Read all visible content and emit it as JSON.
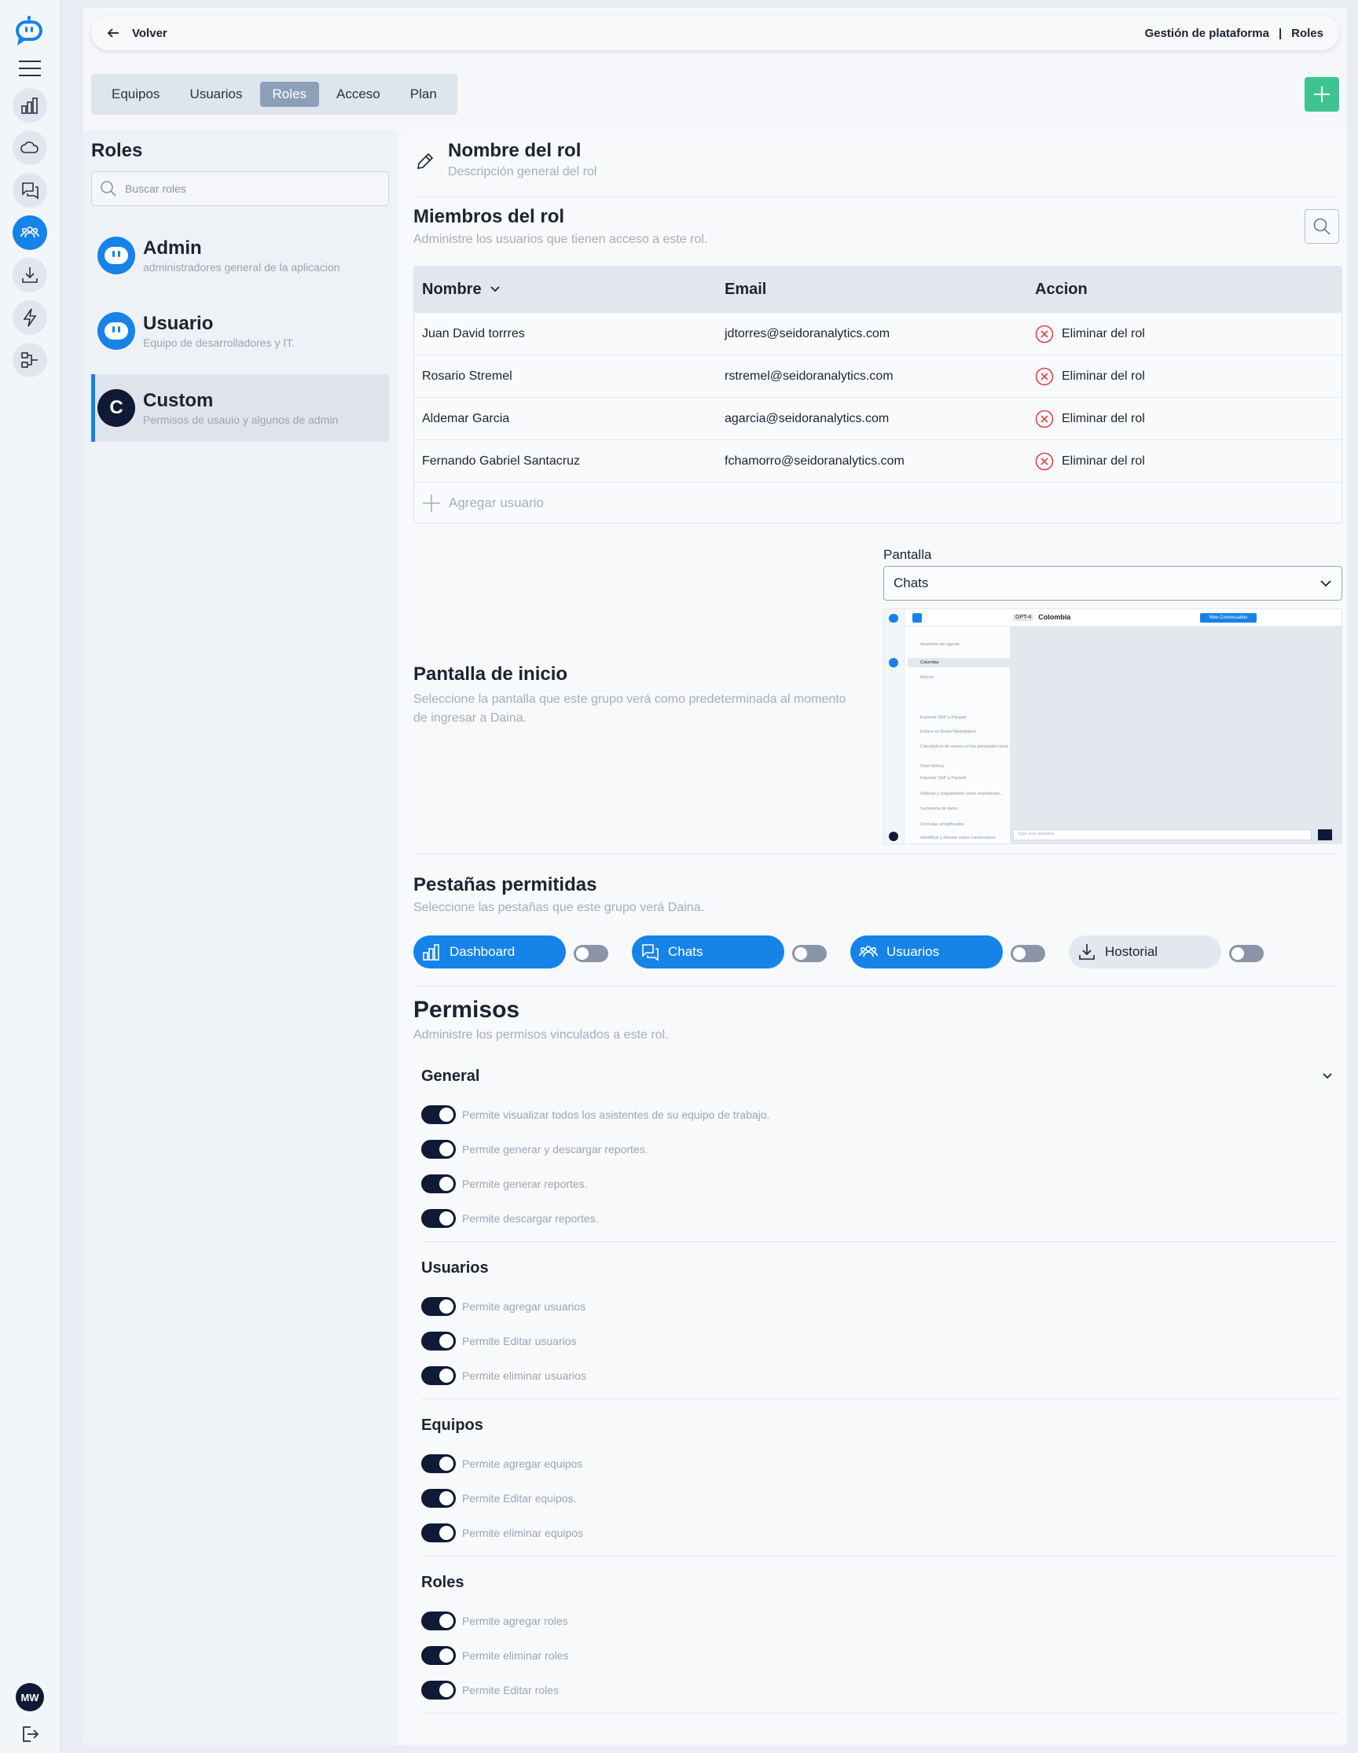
{
  "sidebar": {
    "avatar_initials": "MW",
    "items": [
      {
        "icon": "chart-icon"
      },
      {
        "icon": "cloud-icon"
      },
      {
        "icon": "chats-icon"
      },
      {
        "icon": "users-icon",
        "active": true
      },
      {
        "icon": "download-icon"
      },
      {
        "icon": "bolt-icon"
      },
      {
        "icon": "flow-icon"
      }
    ]
  },
  "topbar": {
    "back_label": "Volver",
    "crumb_1": "Gestión de plataforma",
    "crumb_sep": "|",
    "crumb_2": "Roles"
  },
  "tabs": [
    "Equipos",
    "Usuarios",
    "Roles",
    "Acceso",
    "Plan"
  ],
  "active_tab": "Roles",
  "roles": {
    "title": "Roles",
    "search_placeholder": "Buscar roles",
    "items": [
      {
        "name": "Admin",
        "desc": "administradores general de la aplicacion"
      },
      {
        "name": "Usuario",
        "desc": "Equipo de desarrolladores y IT."
      },
      {
        "name": "Custom",
        "desc": "Permisos de usauio y algunos de admin",
        "initial": "C"
      }
    ]
  },
  "role_header": {
    "title": "Nombre del rol",
    "subtitle": "Descripción general del rol"
  },
  "members": {
    "title": "Miembros del rol",
    "subtitle": "Administre los usuarios que tienen acceso a este rol.",
    "columns": [
      "Nombre",
      "Email",
      "Accion"
    ],
    "rows": [
      {
        "name": "Juan David torrres",
        "email": "jdtorres@seidoranalytics.com",
        "action": "Eliminar del rol"
      },
      {
        "name": "Rosario Stremel",
        "email": "rstremel@seidoranalytics.com",
        "action": "Eliminar del rol"
      },
      {
        "name": "Aldemar Garcia",
        "email": "agarcia@seidoranalytics.com",
        "action": "Eliminar del rol"
      },
      {
        "name": "Fernando Gabriel Santacruz",
        "email": "fchamorro@seidoranalytics.com",
        "action": "Eliminar del rol"
      }
    ],
    "add_label": "Agregar usuario"
  },
  "home_screen": {
    "title": "Pantalla de inicio",
    "subtitle": "Seleccione la pantalla que este grupo verá como predeterminada al momento de ingresar a Daina.",
    "select_label": "Pantalla",
    "select_value": "Chats",
    "preview_country": "Colombia",
    "preview_model": "GPT-4",
    "preview_button": "New Conversation",
    "preview_placeholder": "Type your question",
    "preview_items": [
      "Asistente del agente",
      "Colombia",
      "México"
    ],
    "preview_list": [
      "Exportar SAP a Parquet",
      "Enlace en Bolsa Marketplace",
      "Calculadora de ventas en los principales prod..."
    ],
    "preview_list2_title": "Chat History",
    "preview_list2": [
      "Exportar SAP a Parquet",
      "Obtener y Seguimiento como exportación...",
      "Sumatoria de datos",
      "Fórmulas simplificadas",
      "Identificar y desviar sobre comercianos"
    ]
  },
  "tabs_allowed": {
    "title": "Pestañas permitidas",
    "subtitle": "Seleccione las pestañas que este grupo verá Daina.",
    "items": [
      {
        "label": "Dashboard",
        "icon": "chart-icon",
        "on": true
      },
      {
        "label": "Chats",
        "icon": "chats-icon",
        "on": true
      },
      {
        "label": "Usuarios",
        "icon": "users-icon",
        "on": true
      },
      {
        "label": "Hostorial",
        "icon": "download-icon",
        "on": false
      }
    ]
  },
  "permissions": {
    "title": "Permisos",
    "subtitle": "Administre los permisos vinculados a este rol.",
    "groups": [
      {
        "title": "General",
        "items": [
          "Permite visualizar todos los asistentes de su equipo de trabajo.",
          "Permite generar y descargar reportes.",
          "Permite generar reportes.",
          "Permite descargar reportes."
        ]
      },
      {
        "title": "Usuarios",
        "items": [
          "Permite agregar usuarios",
          "Permite Editar usuarios",
          "Permite eliminar usuarios"
        ]
      },
      {
        "title": "Equipos",
        "items": [
          "Permite agregar equipos",
          "Permite Editar equipos.",
          "Permite eliminar equipos"
        ]
      },
      {
        "title": "Roles",
        "items": [
          "Permite agregar roles",
          "Permite eliminar roles",
          "Permite Editar roles"
        ]
      }
    ]
  },
  "colors": {
    "accent": "#1583e8",
    "dark": "#0e1a36",
    "success": "#3ec58f",
    "danger": "#e0404b"
  }
}
